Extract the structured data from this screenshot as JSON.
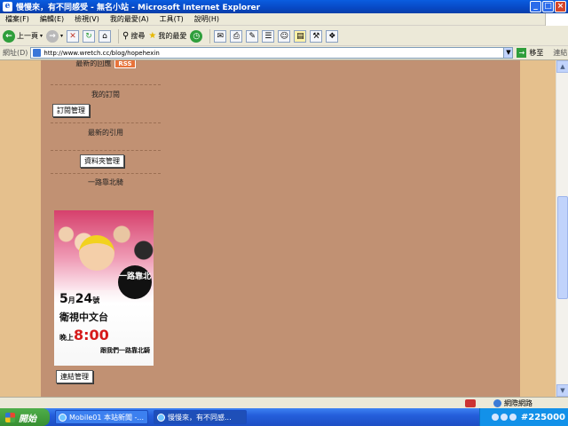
{
  "window": {
    "title": "慢慢來，有不同感受 - 無名小站 - Microsoft Internet Explorer",
    "buttons": {
      "minimize": "_",
      "maximize": "□",
      "close": "×"
    }
  },
  "menubar": {
    "items": [
      "檔案(F)",
      "編輯(E)",
      "檢視(V)",
      "我的最愛(A)",
      "工具(T)",
      "說明(H)"
    ]
  },
  "toolbar": {
    "back_label": "上一頁",
    "search_label": "搜尋",
    "favorites_label": "我的最愛"
  },
  "addressbar": {
    "label": "網址(D)",
    "url": "http://www.wretch.cc/blog/hopehexin",
    "go_label": "移至",
    "links_label": "連結"
  },
  "sidebar": {
    "latest_replies": "最新的回應",
    "rss_badge": "RSS",
    "my_subscriptions": "我的訂閱",
    "subscription_button": "訂閱管理",
    "latest_trackbacks": "最新的引用",
    "folder_button": "資料夾管理",
    "ride_north": "一路靠北騎",
    "link_button": "連結管理"
  },
  "poster": {
    "badge": "一路靠北",
    "date_month": "5",
    "date_month_unit": "月",
    "date_day": "24",
    "date_day_unit": "號",
    "channel": "衛視中文台",
    "time_prefix": "晚上",
    "time": "8:00",
    "tagline": "跟我們一路靠北騎"
  },
  "statusbar": {
    "zone": "網際網路"
  },
  "taskbar": {
    "start_label": "開始",
    "tasks": [
      "Mobile01 本站新聞 -...",
      "慢慢來，有不同感..."
    ],
    "clock": "#225000"
  }
}
